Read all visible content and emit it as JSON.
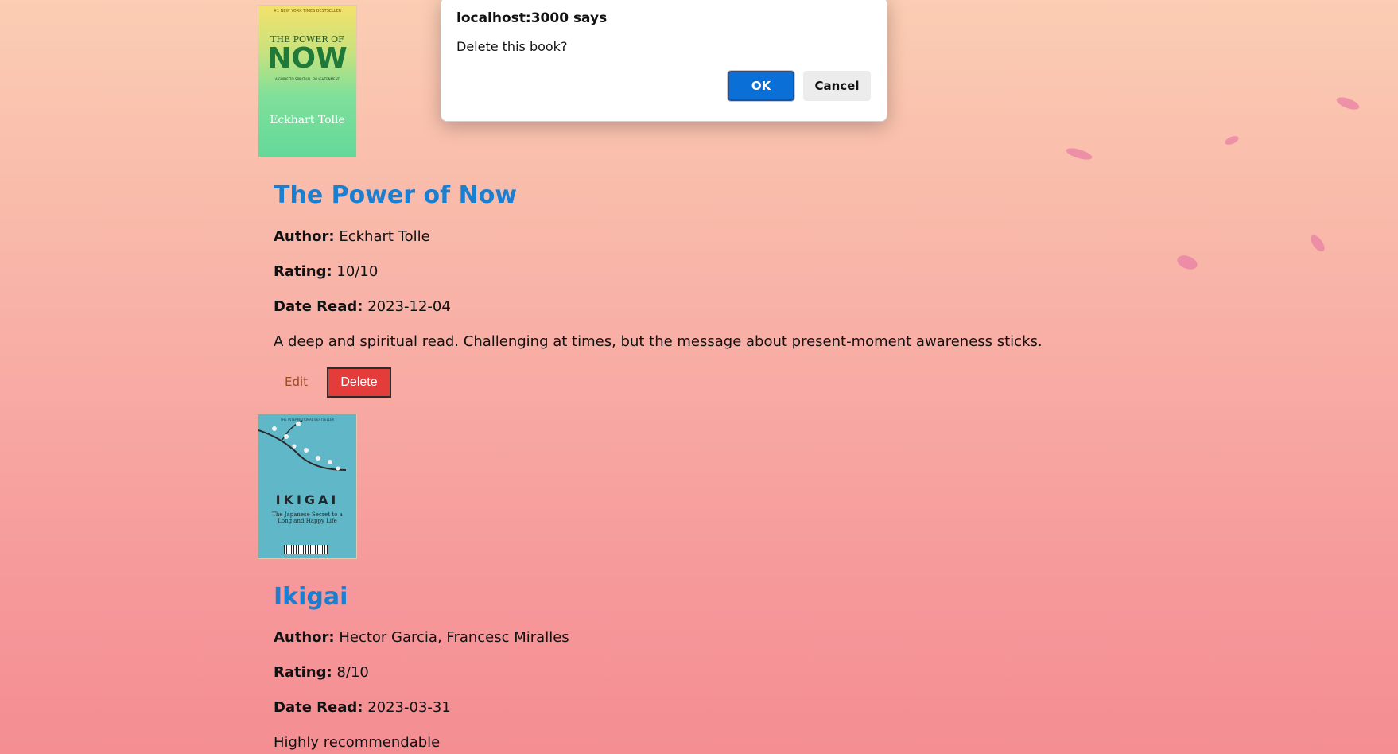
{
  "dialog": {
    "title": "localhost:3000 says",
    "message": "Delete this book?",
    "ok_label": "OK",
    "cancel_label": "Cancel"
  },
  "books": [
    {
      "title": "The Power of Now",
      "author_label": "Author:",
      "author": "Eckhart Tolle",
      "rating_label": "Rating:",
      "rating": "10/10",
      "date_label": "Date Read:",
      "date": "2023-12-04",
      "notes": "A deep and spiritual read. Challenging at times, but the message about present-moment awareness sticks.",
      "edit_label": "Edit",
      "delete_label": "Delete",
      "cover": {
        "top_line": "#1 NEW YORK TIMES BESTSELLER",
        "title_line1": "THE POWER OF",
        "title_line2": "NOW",
        "subtitle": "A GUIDE TO SPIRITUAL ENLIGHTENMENT",
        "author": "Eckhart Tolle"
      }
    },
    {
      "title": "Ikigai",
      "author_label": "Author:",
      "author": "Hector Garcia, Francesc Miralles",
      "rating_label": "Rating:",
      "rating": "8/10",
      "date_label": "Date Read:",
      "date": "2023-03-31",
      "notes": "Highly recommendable",
      "cover": {
        "top_line": "THE INTERNATIONAL BESTSELLER",
        "title": "IKIGAI",
        "subtitle": "The Japanese Secret to a Long and Happy Life"
      }
    }
  ],
  "colors": {
    "title_blue": "#1a7fd0",
    "delete_red": "#e43b3b",
    "ok_blue": "#0a6fd6"
  }
}
